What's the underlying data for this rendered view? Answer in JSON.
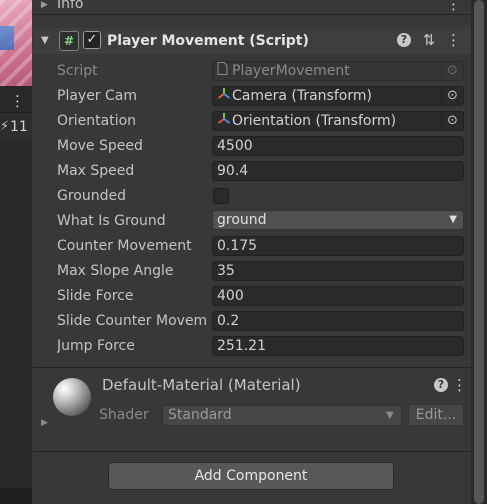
{
  "left_panel": {
    "menu_icon": "kebab-menu-icon",
    "layer_count_icon": "layers-icon",
    "layer_count": "11"
  },
  "info_section": {
    "label": "Info",
    "menu_icon": "kebab-menu-icon"
  },
  "component": {
    "script_icon": "script-hash-icon",
    "script_icon_glyph": "#",
    "enabled_check": "✓",
    "enabled": true,
    "title": "Player Movement (Script)",
    "help_icon_glyph": "?",
    "preset_icon": "sliders-icon",
    "menu_icon": "kebab-menu-icon",
    "properties": {
      "script": {
        "label": "Script",
        "value": "PlayerMovement"
      },
      "player_cam": {
        "label": "Player Cam",
        "value": "Camera (Transform)"
      },
      "orientation": {
        "label": "Orientation",
        "value": "Orientation (Transform)"
      },
      "move_speed": {
        "label": "Move Speed",
        "value": "4500"
      },
      "max_speed": {
        "label": "Max Speed",
        "value": "90.4"
      },
      "grounded": {
        "label": "Grounded",
        "checked": false
      },
      "what_is_ground": {
        "label": "What Is Ground",
        "value": "ground"
      },
      "counter_movement": {
        "label": "Counter Movement",
        "value": "0.175"
      },
      "max_slope_angle": {
        "label": "Max Slope Angle",
        "value": "35"
      },
      "slide_force": {
        "label": "Slide Force",
        "value": "400"
      },
      "slide_counter_movement": {
        "label": "Slide Counter Movem",
        "value": "0.2"
      },
      "jump_force": {
        "label": "Jump Force",
        "value": "251.21"
      }
    }
  },
  "material": {
    "title": "Default-Material (Material)",
    "help_icon_glyph": "?",
    "shader_label": "Shader",
    "shader_value": "Standard",
    "edit_label": "Edit..."
  },
  "add_component_label": "Add Component",
  "colors": {
    "panel_bg": "#383838",
    "field_bg": "#2a2a2a",
    "script_icon_green": "#84d183"
  }
}
